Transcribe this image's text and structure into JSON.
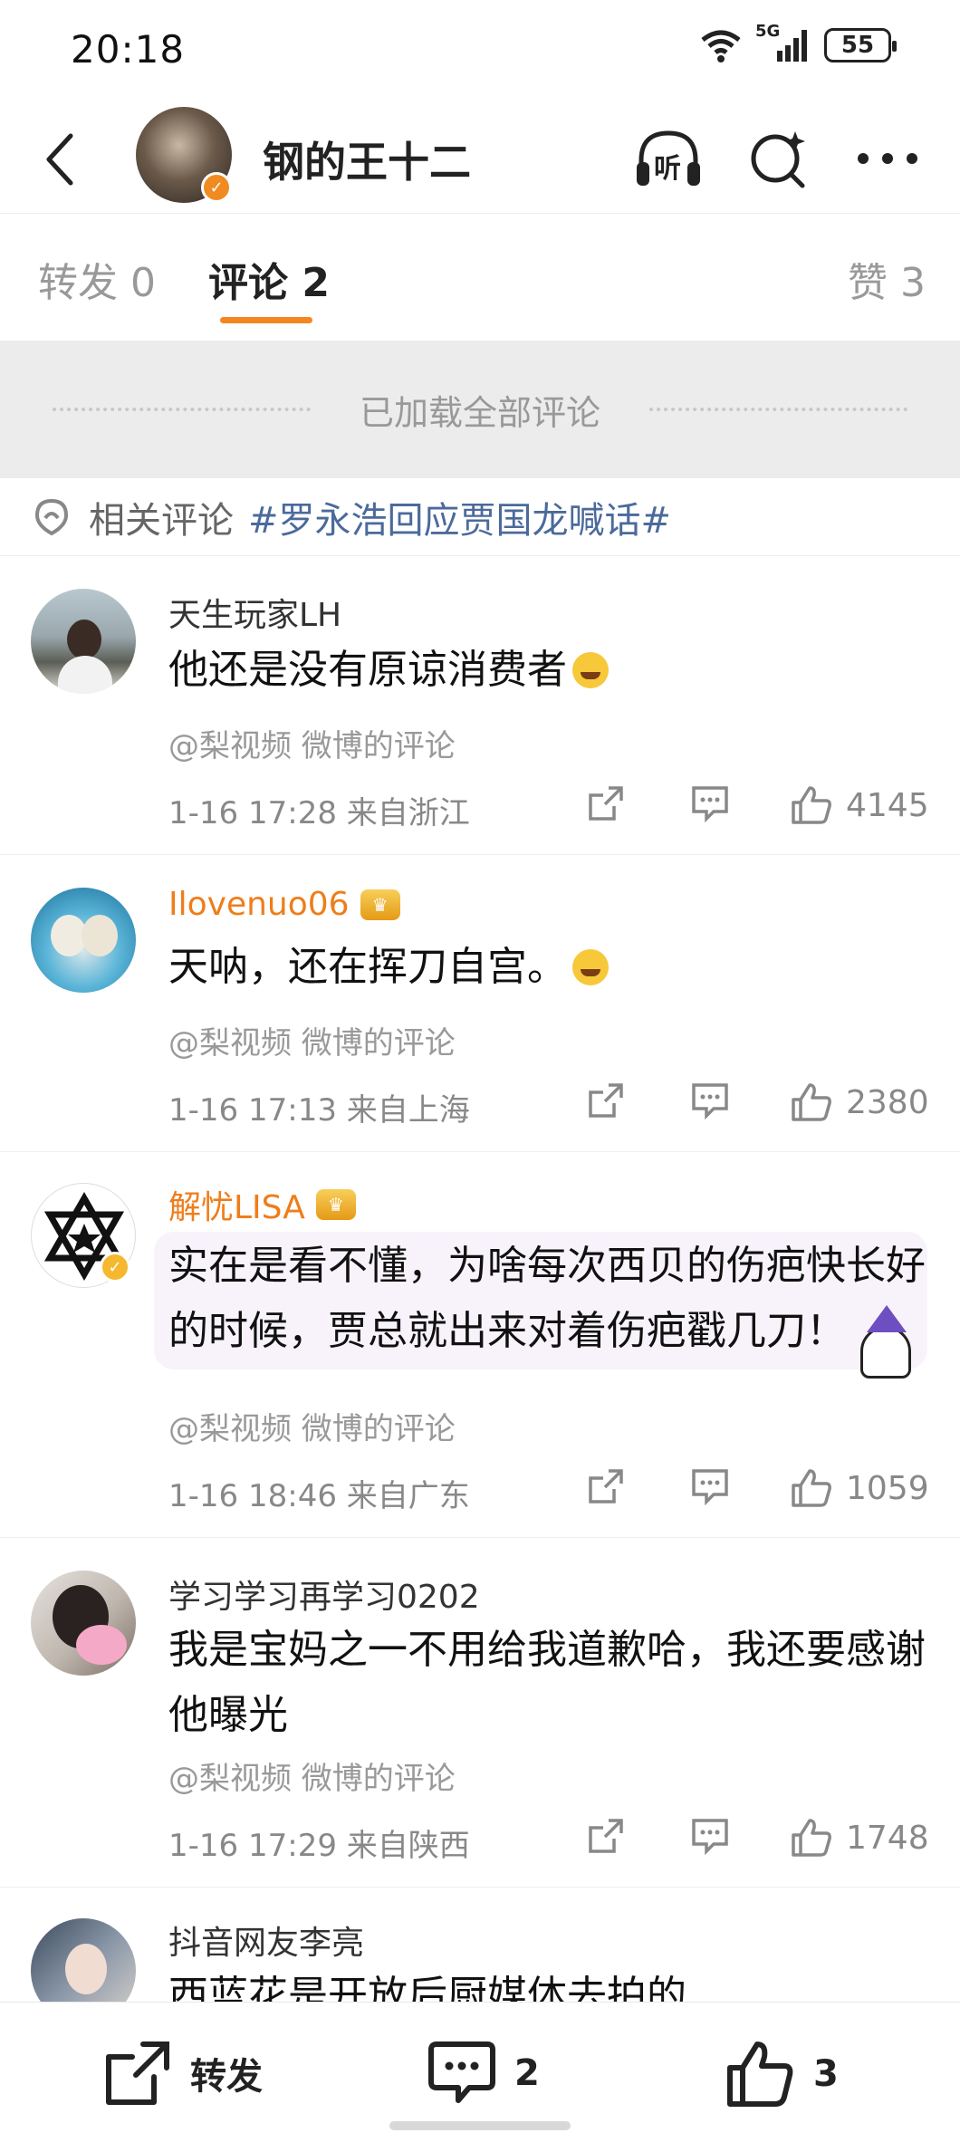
{
  "status_bar": {
    "time": "20:18",
    "network": "5G",
    "battery": "55"
  },
  "header": {
    "user_name": "钢的王十二",
    "listen_label": "听"
  },
  "tabs": [
    {
      "label": "转发 0"
    },
    {
      "label": "评论 2"
    },
    {
      "label": "赞 3"
    }
  ],
  "loaded_text": "已加载全部评论",
  "related": {
    "label": "相关评论",
    "topic": "#罗永浩回应贾国龙喊话#"
  },
  "comments": [
    {
      "name": "天生玩家LH",
      "text": "他还是没有原谅消费者",
      "source": "@梨视频 微博的评论",
      "meta": "1-16 17:28 来自浙江",
      "likes": "4145"
    },
    {
      "name": "Ilovenuo06",
      "text": "天呐，还在挥刀自宫。",
      "source": "@梨视频 微博的评论",
      "meta": "1-16 17:13 来自上海",
      "likes": "2380"
    },
    {
      "name": "解忧LISA",
      "text": "实在是看不懂，为啥每次西贝的伤疤快长好的时候，贾总就出来对着伤疤戳几刀！",
      "source": "@梨视频 微博的评论",
      "meta": "1-16 18:46 来自广东",
      "likes": "1059"
    },
    {
      "name": "学习学习再学习0202",
      "text": "我是宝妈之一不用给我道歉哈，我还要感谢他曝光",
      "source": "@梨视频 微博的评论",
      "meta": "1-16 17:29 来自陕西",
      "likes": "1748"
    },
    {
      "name": "抖音网友李亮",
      "text": "西蓝花是开放后厨媒体去拍的"
    }
  ],
  "bottom_bar": {
    "repost_label": "转发",
    "comment_count": "2",
    "like_count": "3"
  },
  "colors": {
    "accent": "#f5861f",
    "topic_link": "#4b6a9b",
    "vip_name": "#ef7d1a"
  }
}
